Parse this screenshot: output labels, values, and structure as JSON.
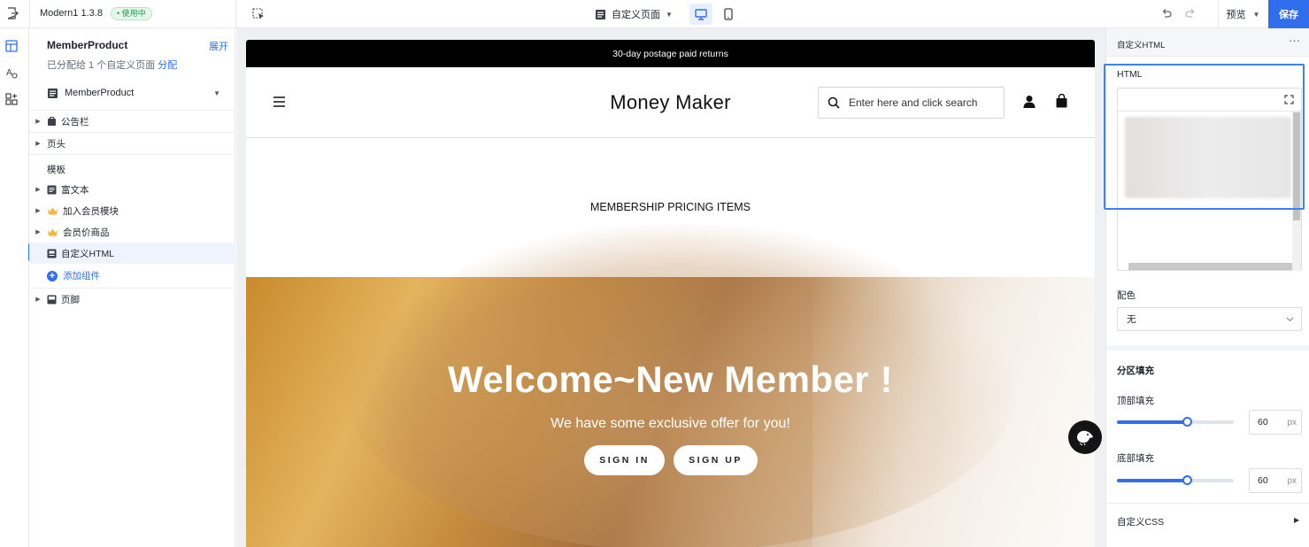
{
  "topbar": {
    "app_title": "Modern1 1.3.8",
    "status_badge": "• 使用中",
    "page_select": "自定义页面",
    "preview_label": "预览",
    "save_label": "保存"
  },
  "sidebar": {
    "title": "MemberProduct",
    "expand_label": "展开",
    "assigned_text": "已分配给 1 个自定义页面",
    "assign_link": "分配",
    "template_select": "MemberProduct",
    "items": [
      {
        "label": "公告栏"
      },
      {
        "label": "页头"
      }
    ],
    "section_label": "模板",
    "template_items": [
      {
        "label": "富文本"
      },
      {
        "label": "加入会员模块"
      },
      {
        "label": "会员价商品"
      },
      {
        "label": "自定义HTML"
      }
    ],
    "add_component": "添加组件",
    "footer_item": "页脚"
  },
  "canvas": {
    "announcement": "30-day postage paid returns",
    "brand": "Money Maker",
    "search_placeholder": "Enter here and click search",
    "section_title": "MEMBERSHIP PRICING ITEMS",
    "hero_title": "Welcome~New Member !",
    "hero_subtitle": "We have some exclusive offer for you!",
    "sign_in": "SIGN IN",
    "sign_up": "SIGN UP"
  },
  "panel": {
    "header_title": "自定义HTML",
    "more": "···",
    "html_label": "HTML",
    "color_label": "配色",
    "color_value": "无",
    "padding_group": "分区填充",
    "top_padding_label": "顶部填充",
    "top_padding_value": "60",
    "top_padding_fraction": 0.6,
    "bottom_padding_label": "底部填充",
    "bottom_padding_value": "60",
    "bottom_padding_fraction": 0.6,
    "unit": "px",
    "custom_css": "自定义CSS"
  },
  "colors": {
    "accent": "#2f6fed",
    "badge_green": "#1a9a4b"
  }
}
